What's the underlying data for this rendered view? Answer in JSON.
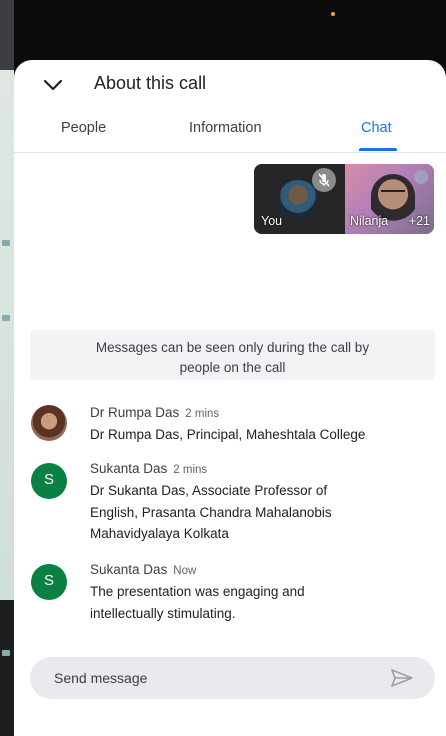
{
  "header": {
    "title": "About this call"
  },
  "tabs": [
    {
      "label": "People"
    },
    {
      "label": "Information"
    },
    {
      "label": "Chat"
    }
  ],
  "active_tab": "Chat",
  "participants_strip": {
    "self_label": "You",
    "other_label": "Nilanja",
    "more_count": "+21",
    "self_muted": true
  },
  "notice": {
    "line1": "Messages can be seen only during the call by",
    "line2": "people on the call"
  },
  "messages": [
    {
      "sender": "Dr Rumpa Das",
      "time": "2 mins",
      "text": "Dr Rumpa Das, Principal, Maheshtala College",
      "avatar": "photo"
    },
    {
      "sender": "Sukanta Das",
      "time": "2 mins",
      "text_lines": [
        "Dr Sukanta Das, Associate Professor of",
        "English, Prasanta Chandra Mahalanobis",
        "Mahavidyalaya Kolkata"
      ],
      "avatar_letter": "S"
    },
    {
      "sender": "Sukanta Das",
      "time": "Now",
      "text_lines": [
        "The presentation was engaging and",
        "intellectually stimulating."
      ],
      "avatar_letter": "S"
    }
  ],
  "composer": {
    "placeholder": "Send message"
  },
  "colors": {
    "accent": "#1a73e8",
    "avatar_green": "#0b8043",
    "notice_bg": "#f1f3f4",
    "composer_bg": "#e8eaed"
  },
  "icons": {
    "collapse": "chevron-down-icon",
    "send": "send-icon",
    "muted": "mic-off-icon"
  }
}
